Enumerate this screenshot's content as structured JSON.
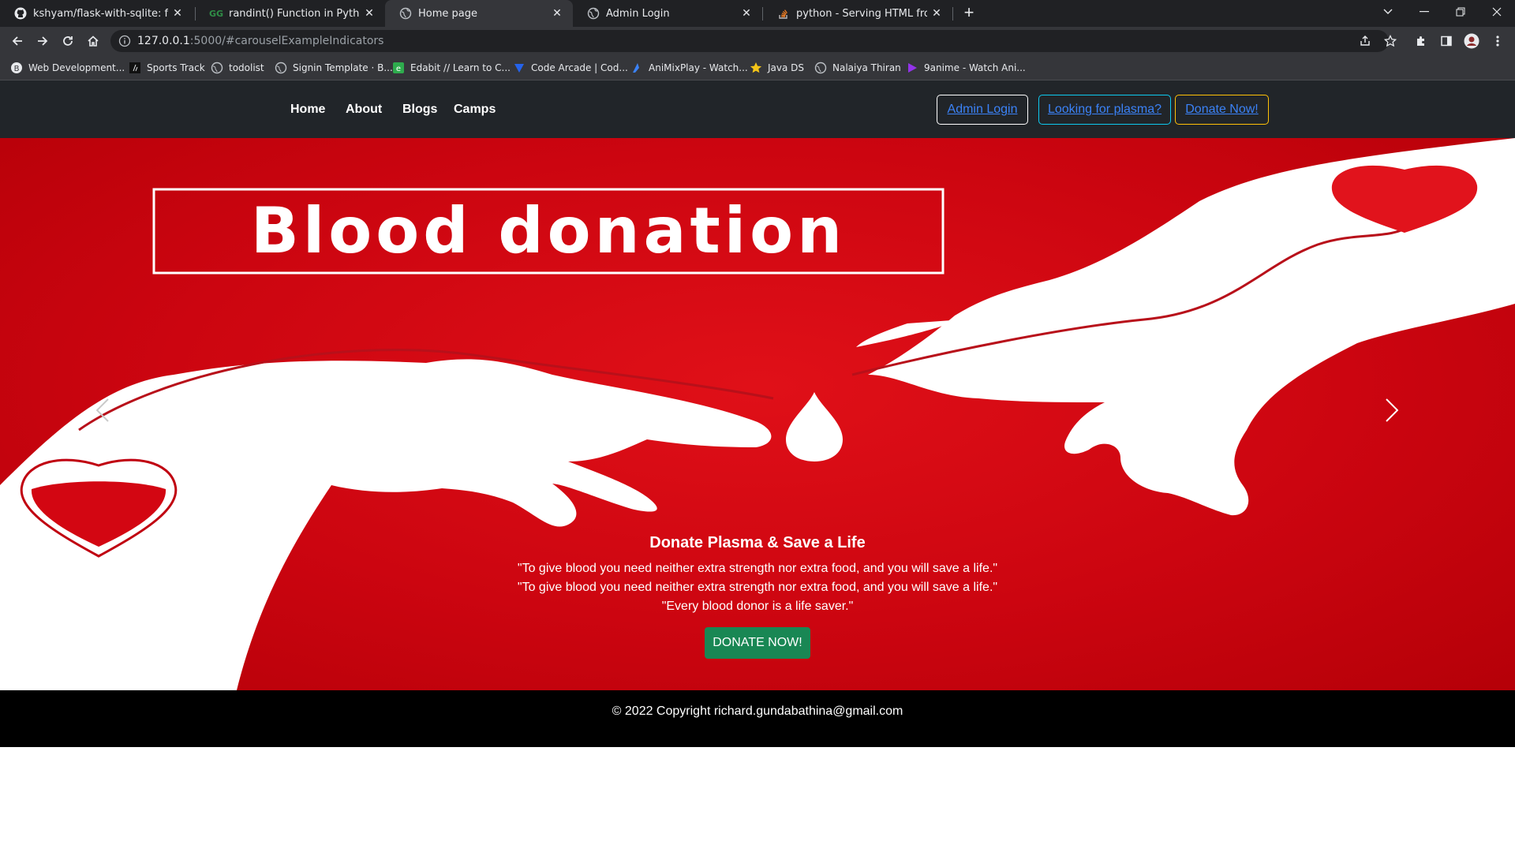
{
  "browser": {
    "tabs": [
      {
        "title": "kshyam/flask-with-sqlite: flask-w",
        "icon": "github-icon"
      },
      {
        "title": "randint() Function in Python - Ge",
        "icon": "geeksforgeeks-icon"
      },
      {
        "title": "Home page",
        "icon": "globe-icon",
        "active": true
      },
      {
        "title": "Admin Login",
        "icon": "globe-icon"
      },
      {
        "title": "python - Serving HTML from Flas",
        "icon": "stackoverflow-icon"
      }
    ],
    "url_host": "127.0.0.1",
    "url_rest": ":5000/#carouselExampleIndicators",
    "bookmarks": [
      "Web Development...",
      "Sports Track",
      "todolist",
      "Signin Template · B...",
      "Edabit // Learn to C...",
      "Code Arcade | Cod...",
      "AniMixPlay - Watch...",
      "Java DS",
      "Nalaiya Thiran",
      "9anime - Watch Ani..."
    ]
  },
  "nav": {
    "links": [
      "Home",
      "About",
      "Blogs",
      "Camps"
    ],
    "buttons": {
      "admin": "Admin Login",
      "plasma": "Looking for plasma?",
      "donate": "Donate Now!"
    }
  },
  "hero": {
    "banner_text": "Blood donation",
    "caption_title": "Donate Plasma & Save a Life",
    "quotes": [
      "\"To give blood you need neither extra strength nor extra food, and you will save a life.\"",
      "\"To give blood you need neither extra strength nor extra food, and you will save a life.\"",
      "\"Every blood donor is a life saver.\""
    ],
    "cta": "DONATE NOW!"
  },
  "footer": {
    "text": "© 2022 Copyright richard.gundabathina@gmail.com"
  },
  "colors": {
    "navbar": "#212529",
    "hero_red": "#cc0510",
    "button_green": "#198754",
    "link_blue": "#3b82f6",
    "outline_info": "#0dcaf0",
    "outline_warning": "#ffc107"
  }
}
